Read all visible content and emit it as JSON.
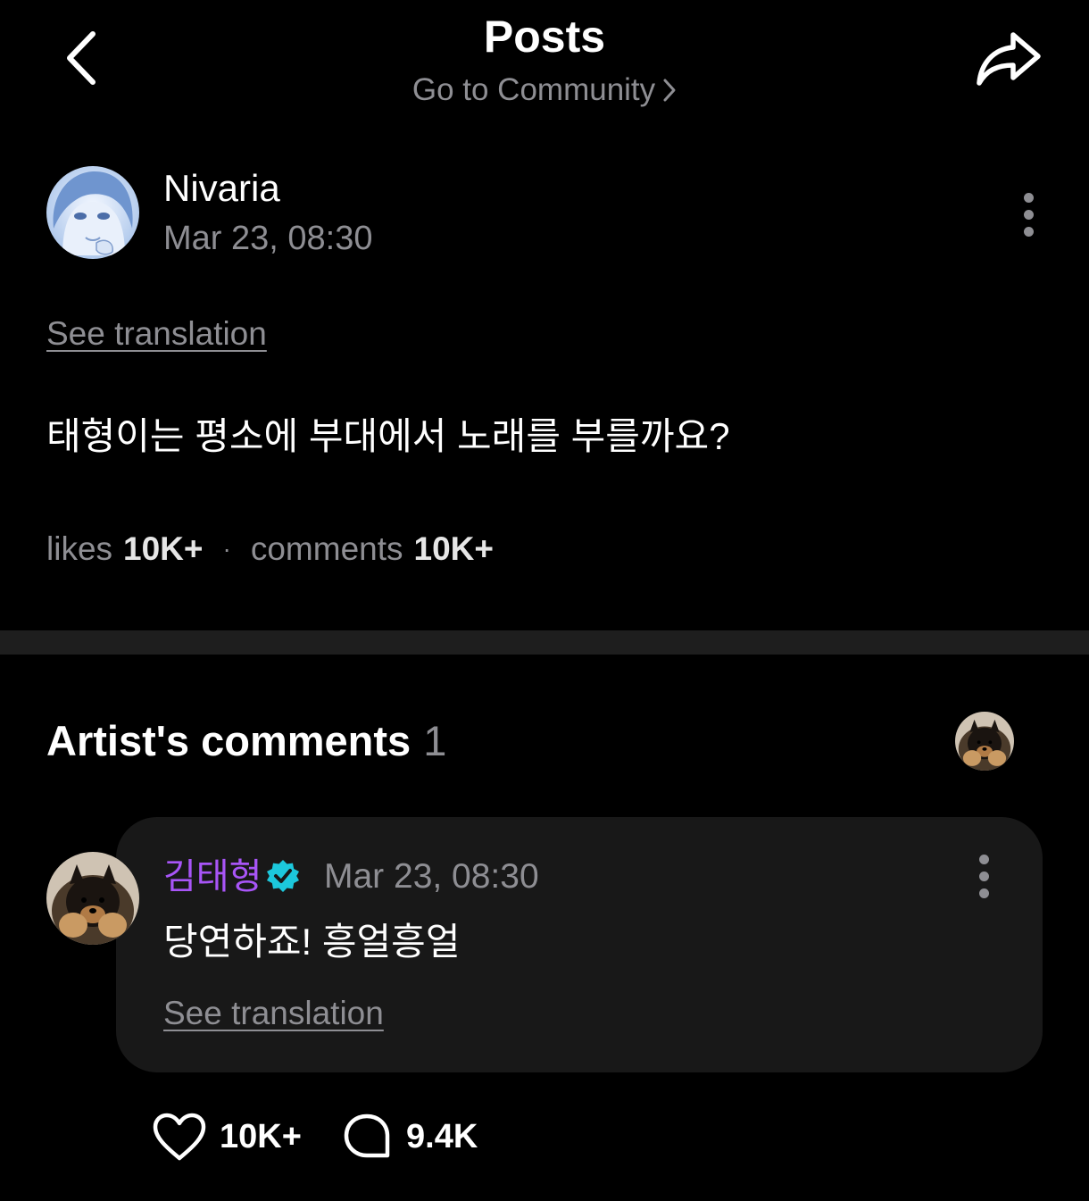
{
  "header": {
    "title": "Posts",
    "community_link": "Go to Community"
  },
  "post": {
    "author_name": "Nivaria",
    "date": "Mar 23, 08:30",
    "translation_link": "See translation",
    "body": "태형이는 평소에 부대에서 노래를 부를까요?",
    "stats": {
      "likes_label": "likes",
      "likes_value": "10K+",
      "separator": "·",
      "comments_label": "comments",
      "comments_value": "10K+"
    }
  },
  "artist_comments": {
    "title": "Artist's comments",
    "count": "1",
    "comment": {
      "author_name": "김태형",
      "date": "Mar 23, 08:30",
      "body": "당연하죠! 흥얼흥얼",
      "translation_link": "See translation",
      "likes": "10K+",
      "replies": "9.4K"
    }
  },
  "colors": {
    "background": "#000000",
    "secondary_text": "#8e8e93",
    "artist_name": "#a855f7",
    "verified_badge": "#1cc8dc",
    "card": "#181818"
  },
  "icons": {
    "back": "chevron-left-icon",
    "share": "share-arrow-icon",
    "community_chevron": "chevron-right-icon",
    "more": "more-vertical-icon",
    "verified": "verified-badge-icon",
    "like": "heart-icon",
    "reply": "chat-bubble-icon"
  }
}
